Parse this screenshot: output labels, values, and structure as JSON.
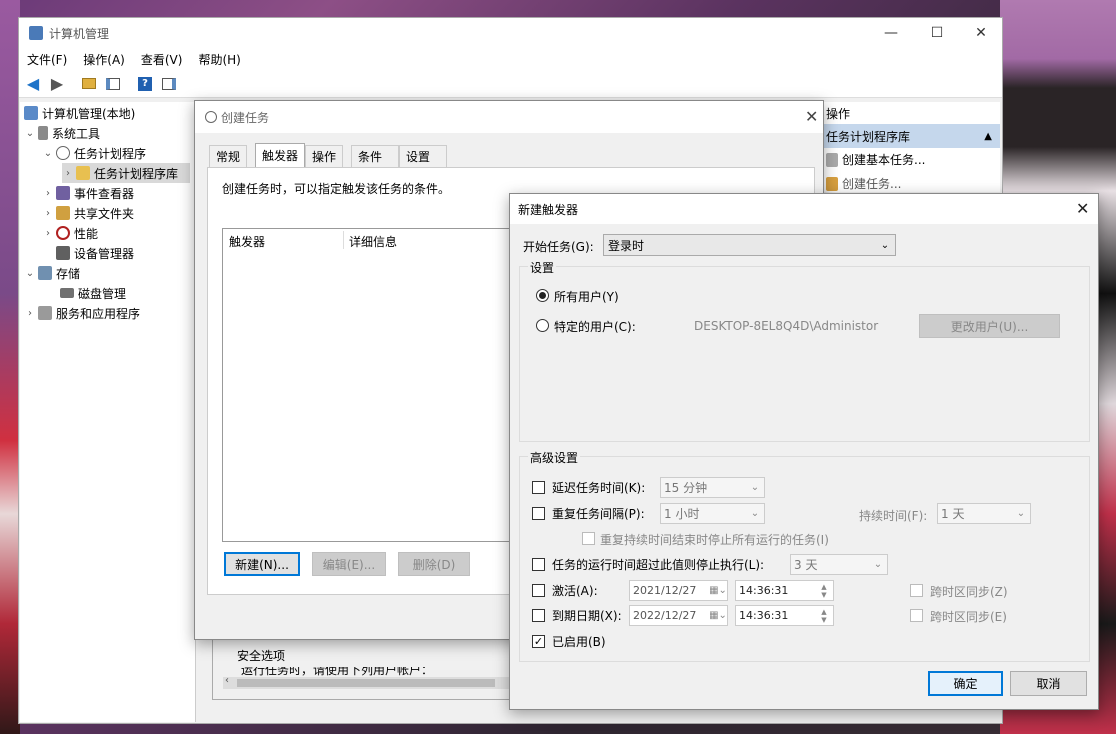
{
  "main_window": {
    "title": "计算机管理",
    "controls": {
      "minimize": "—",
      "maximize": "☐",
      "close": "✕"
    },
    "menu": [
      "文件(F)",
      "操作(A)",
      "查看(V)",
      "帮助(H)"
    ]
  },
  "tree": [
    {
      "label": "计算机管理(本地)"
    },
    {
      "label": "系统工具"
    },
    {
      "label": "任务计划程序"
    },
    {
      "label": "任务计划程序库"
    },
    {
      "label": "事件查看器"
    },
    {
      "label": "共享文件夹"
    },
    {
      "label": "性能"
    },
    {
      "label": "设备管理器"
    },
    {
      "label": "存储"
    },
    {
      "label": "磁盘管理"
    },
    {
      "label": "服务和应用程序"
    }
  ],
  "actions_panel": {
    "header": "操作",
    "section": "任务计划程序库",
    "items": [
      "创建基本任务...",
      "创建任务..."
    ]
  },
  "create_task": {
    "title": "创建任务",
    "tabs": [
      "常规",
      "触发器",
      "操作",
      "条件",
      "设置"
    ],
    "description": "创建任务时，可以指定触发该任务的条件。",
    "columns": [
      "触发器",
      "详细信息"
    ],
    "buttons": {
      "new": "新建(N)...",
      "edit": "编辑(E)...",
      "delete": "删除(D)"
    },
    "security_label": "安全选项",
    "security_text": "运行任务时，请使用下列用户帐户："
  },
  "new_trigger": {
    "title": "新建触发器",
    "begin_label": "开始任务(G):",
    "begin_value": "登录时",
    "settings_label": "设置",
    "radio_all": "所有用户(Y)",
    "radio_specific": "特定的用户(C):",
    "user_value": "DESKTOP-8EL8Q4D\\Administor",
    "change_user": "更改用户(U)...",
    "advanced_label": "高级设置",
    "delay_label": "延迟任务时间(K):",
    "delay_value": "15 分钟",
    "repeat_label": "重复任务间隔(P):",
    "repeat_value": "1 小时",
    "duration_label": "持续时间(F):",
    "duration_value": "1 天",
    "stop_all_label": "重复持续时间结束时停止所有运行的任务(I)",
    "stop_if_label": "任务的运行时间超过此值则停止执行(L):",
    "stop_if_value": "3 天",
    "activate_label": "激活(A):",
    "activate_date": "2021/12/27",
    "activate_time": "14:36:31",
    "expire_label": "到期日期(X):",
    "expire_date": "2022/12/27",
    "expire_time": "14:36:31",
    "sync_tz1": "跨时区同步(Z)",
    "sync_tz2": "跨时区同步(E)",
    "enabled_label": "已启用(B)",
    "ok": "确定",
    "cancel": "取消"
  }
}
